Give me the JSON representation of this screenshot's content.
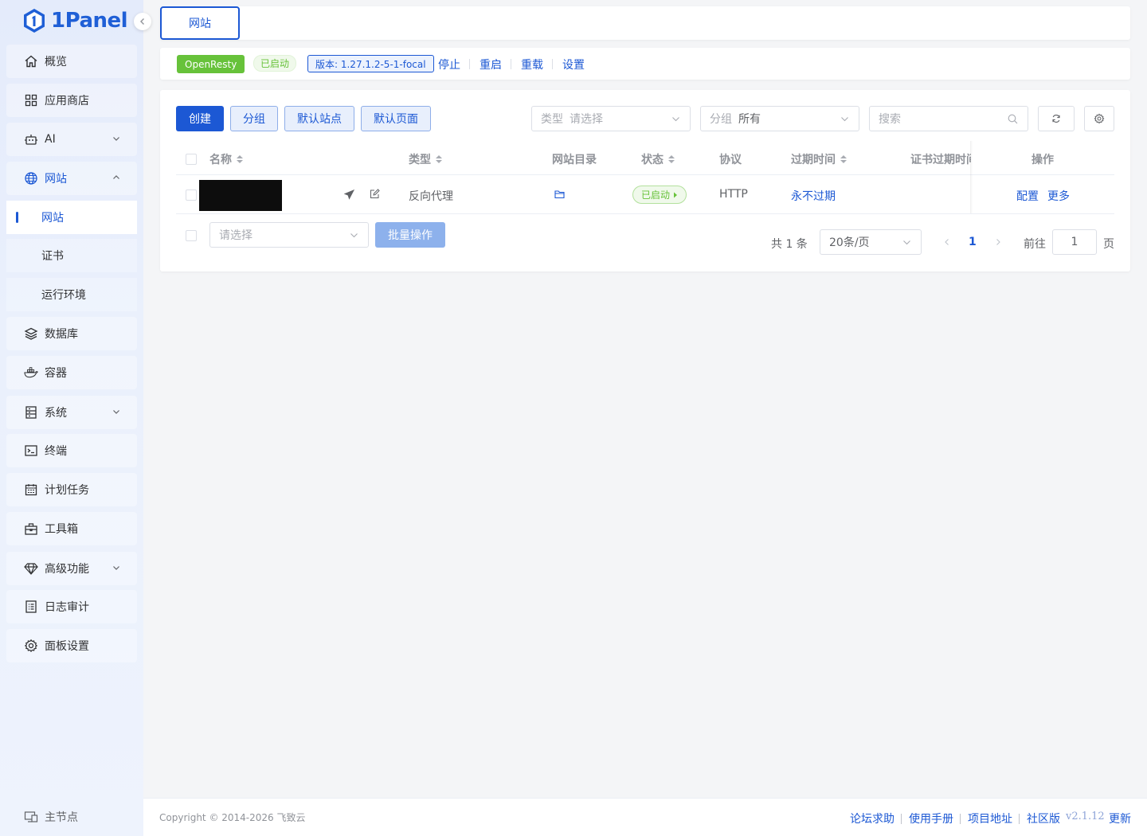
{
  "brand": {
    "name": "1Panel"
  },
  "sidebar": {
    "items": [
      {
        "label": "概览",
        "icon": "home-icon"
      },
      {
        "label": "应用商店",
        "icon": "grid-icon"
      },
      {
        "label": "AI",
        "icon": "robot-icon"
      },
      {
        "label": "网站",
        "icon": "globe-icon"
      },
      {
        "label": "数据库",
        "icon": "layers-icon"
      },
      {
        "label": "容器",
        "icon": "docker-icon"
      },
      {
        "label": "系统",
        "icon": "system-icon"
      },
      {
        "label": "终端",
        "icon": "terminal-icon"
      },
      {
        "label": "计划任务",
        "icon": "calendar-icon"
      },
      {
        "label": "工具箱",
        "icon": "toolbox-icon"
      },
      {
        "label": "高级功能",
        "icon": "diamond-icon"
      },
      {
        "label": "日志审计",
        "icon": "log-icon"
      },
      {
        "label": "面板设置",
        "icon": "gear-icon"
      }
    ],
    "website_children": [
      "网站",
      "证书",
      "运行环境"
    ],
    "host_node": "主节点"
  },
  "tabs": {
    "active": "网站"
  },
  "appbar": {
    "app_name": "OpenResty",
    "status": "已启动",
    "version": "版本: 1.27.1.2-5-1-focal",
    "actions": [
      "停止",
      "重启",
      "重载",
      "设置"
    ]
  },
  "toolbar": {
    "create": "创建",
    "group": "分组",
    "default_site": "默认站点",
    "default_page": "默认页面",
    "type_filter": {
      "label": "类型",
      "placeholder": "请选择"
    },
    "group_filter": {
      "label": "分组",
      "value": "所有"
    },
    "search_placeholder": "搜索"
  },
  "table": {
    "columns": [
      "名称",
      "类型",
      "网站目录",
      "状态",
      "协议",
      "过期时间",
      "证书过期时间",
      "操作"
    ],
    "rows": [
      {
        "type": "反向代理",
        "status": "已启动",
        "protocol": "HTTP",
        "expire": "永不过期",
        "actions": [
          "配置",
          "更多"
        ]
      }
    ]
  },
  "bulk": {
    "placeholder": "请选择",
    "button": "批量操作"
  },
  "pagination": {
    "total": "共 1 条",
    "page_size": "20条/页",
    "current": "1",
    "goto_label": "前往",
    "goto_value": "1",
    "page_suffix": "页"
  },
  "footer": {
    "copyright": "Copyright © 2014-2026 飞致云",
    "links": [
      "论坛求助",
      "使用手册",
      "项目地址",
      "社区版"
    ],
    "version": "v2.1.12",
    "update": "更新"
  },
  "colors": {
    "primary": "#1c58d4",
    "success": "#67c23a"
  }
}
